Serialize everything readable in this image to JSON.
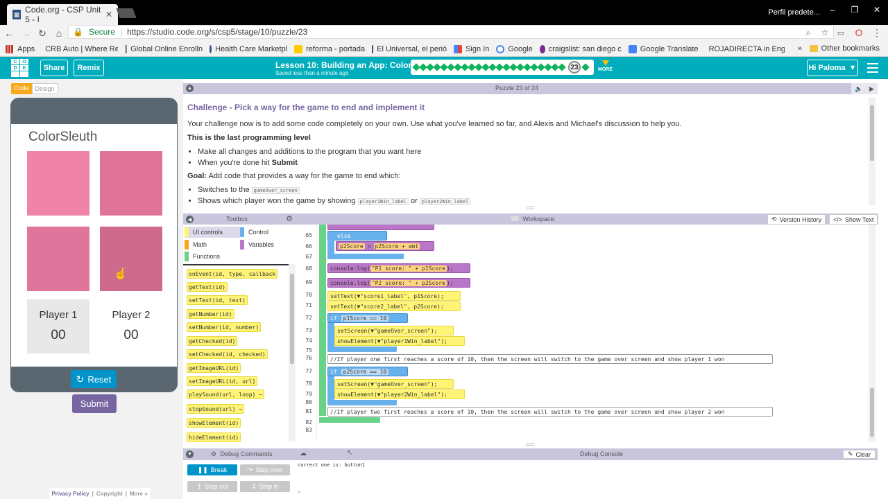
{
  "browser": {
    "tab_title": "Code.org - CSP Unit 5 - I",
    "profile": "Perfil predete...",
    "secure_label": "Secure",
    "url": "https://studio.code.org/s/csp5/stage/10/puzzle/23",
    "bookmarks": [
      {
        "label": "Apps",
        "color": "#c0392b"
      },
      {
        "label": "CRB Auto | Where Re",
        "color": "#c62828"
      },
      {
        "label": "Global Online Enrolln",
        "color": "#555555"
      },
      {
        "label": "Health Care Marketpl",
        "color": "#2f4f7f"
      },
      {
        "label": "reforma - portada",
        "color": "#ffcc00"
      },
      {
        "label": "El Universal, el perió",
        "color": "#2f4f7f"
      },
      {
        "label": "Sign In",
        "color": "#4285f4"
      },
      {
        "label": "Google",
        "color": "#4285f4"
      },
      {
        "label": "craigslist: san diego c",
        "color": "#7b2d8b"
      },
      {
        "label": "Google Translate",
        "color": "#4285f4"
      },
      {
        "label": "ROJADIRECTA in Eng",
        "color": "#555555"
      }
    ],
    "other_bookmarks": "Other bookmarks"
  },
  "header": {
    "share": "Share",
    "remix": "Remix",
    "lesson_title": "Lesson 10: Building an App: Color Sleuth",
    "saved": "Saved less than a minute ago",
    "current_puzzle": "23",
    "more": "MORE",
    "user": "Hi Paloma"
  },
  "left": {
    "code_tab": "Code",
    "design_tab": "Design",
    "app_title": "ColorSleuth",
    "squares": [
      "#ef84a8",
      "#e07498",
      "#e0759b",
      "#ce6b8d"
    ],
    "player1": "Player 1",
    "player2": "Player 2",
    "score1": "00",
    "score2": "00",
    "reset": "Reset",
    "submit": "Submit",
    "privacy": "Privacy Policy",
    "copyright": "Copyright",
    "more": "More »"
  },
  "instructions": {
    "puzzle_label": "Puzzle 23 of 24",
    "title": "Challenge - Pick a way for the game to end and implement it",
    "intro": "Your challenge now is to add some code completely on your own. Use what you've learned so far, and Alexis and Michael's discussion to help you.",
    "level_note": "This is the last programming level",
    "bullet1": "Make all changes and additions to the program that you want here",
    "bullet2_prefix": "When you're done hit",
    "bullet2_bold": "Submit",
    "goal_label": "Goal:",
    "goal_text": "Add code that provides a way for the game to end which:",
    "goal_b1_prefix": "Switches to the",
    "goal_b1_chip": "gameOver_screen",
    "goal_b2_prefix": "Shows which player won the game by showing",
    "goal_b2_chip1": "player1Win_label",
    "goal_b2_or": "or",
    "goal_b2_chip2": "player2Win_label"
  },
  "toolbox": {
    "title": "Toolbox",
    "categories": [
      {
        "label": "UI controls",
        "color": "#fff476"
      },
      {
        "label": "Control",
        "color": "#67b1ec"
      },
      {
        "label": "Math",
        "color": "#f8a919"
      },
      {
        "label": "Variables",
        "color": "#bb77c7"
      },
      {
        "label": "Functions",
        "color": "#68d388"
      }
    ],
    "blocks": [
      "onEvent(id, type, callback",
      "getText(id)",
      "setText(id, text)",
      "getNumber(id)",
      "setNumber(id, number)",
      "getChecked(id)",
      "setChecked(id, checked)",
      "getImageURL(id)",
      "setImageURL(id, url)",
      "playSound(url, loop) −",
      "stopSound(url) −",
      "showElement(id)",
      "hideElement(id)"
    ]
  },
  "workspace": {
    "title": "Workspace:",
    "version_history": "Version History",
    "show_text": "Show Text",
    "line_numbers": [
      "65",
      "66",
      "67",
      "68",
      "69",
      "70",
      "71",
      "72",
      "73",
      "74",
      "75",
      "76",
      "77",
      "78",
      "79",
      "80",
      "81",
      "82",
      "83"
    ],
    "else": "else",
    "p2score_var": "p2Score",
    "p2score_expr": "p2Score + amt",
    "log1_prefix": "console.log(",
    "log1_arg": "\"P1 score: \" + p1Score",
    "log2_arg": "\"P2 score: \" + p2Score",
    "settext1": "setText(▼\"score1_label\", p1Score);",
    "settext2": "setText(▼\"score2_label\", p2Score);",
    "if": "if",
    "cond1": "p1Score == 10",
    "cond2": "p2Score == 10",
    "setscreen": "setScreen(▼\"gameOver_screen\");",
    "show1": "showElement(▼\"player1Win_label\");",
    "show2": "showElement(▼\"player2Win_label\");",
    "comment1": "//If player one first reaches a score of 10, then the screen will switch to the game over screen and show player 1 won",
    "comment2": "//If player two first reaches a score of 10, then the screen will switch to the game over screen and show player 2 won"
  },
  "debug": {
    "commands": "Debug Commands",
    "console_title": "Debug Console",
    "break": "Break",
    "step_over": "Step over",
    "step_out": "Step out",
    "step_in": "Step in",
    "clear": "Clear",
    "log_line": "correct one is: button1",
    "prompt": ">"
  }
}
